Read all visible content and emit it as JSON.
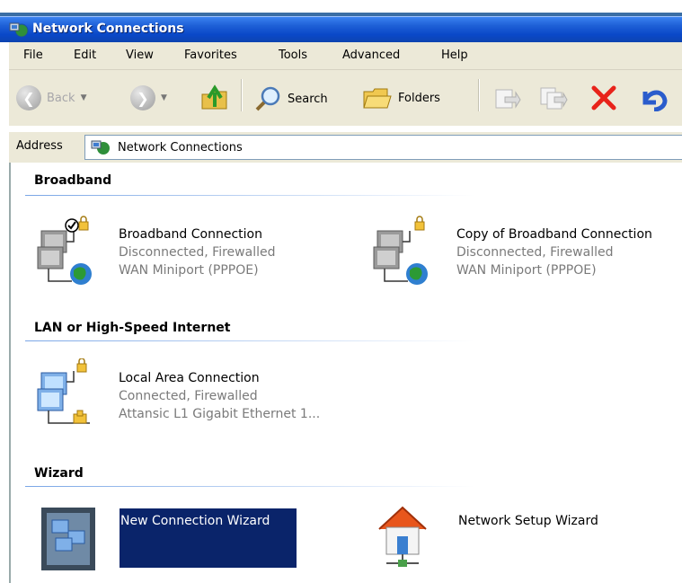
{
  "window": {
    "title": "Network Connections"
  },
  "menu": [
    "File",
    "Edit",
    "View",
    "Favorites",
    "Tools",
    "Advanced",
    "Help"
  ],
  "toolbar": {
    "back_label": "Back",
    "search_label": "Search",
    "folders_label": "Folders"
  },
  "address": {
    "label": "Address",
    "value": "Network Connections"
  },
  "groups": {
    "broadband": {
      "header": "Broadband",
      "items": [
        {
          "name": "Broadband Connection",
          "status": "Disconnected, Firewalled",
          "device": "WAN Miniport (PPPOE)"
        },
        {
          "name": "Copy of Broadband Connection",
          "status": "Disconnected, Firewalled",
          "device": "WAN Miniport (PPPOE)"
        }
      ]
    },
    "lan": {
      "header": "LAN or High-Speed Internet",
      "items": [
        {
          "name": "Local Area Connection",
          "status": "Connected, Firewalled",
          "device": "Attansic L1 Gigabit Ethernet 1..."
        }
      ]
    },
    "wizard": {
      "header": "Wizard",
      "items": [
        {
          "name": "New Connection Wizard"
        },
        {
          "name": "Network Setup Wizard"
        }
      ]
    }
  },
  "colors": {
    "titlebar": "#0a48c8",
    "selection": "#0a246a",
    "chrome": "#ece9d8"
  }
}
